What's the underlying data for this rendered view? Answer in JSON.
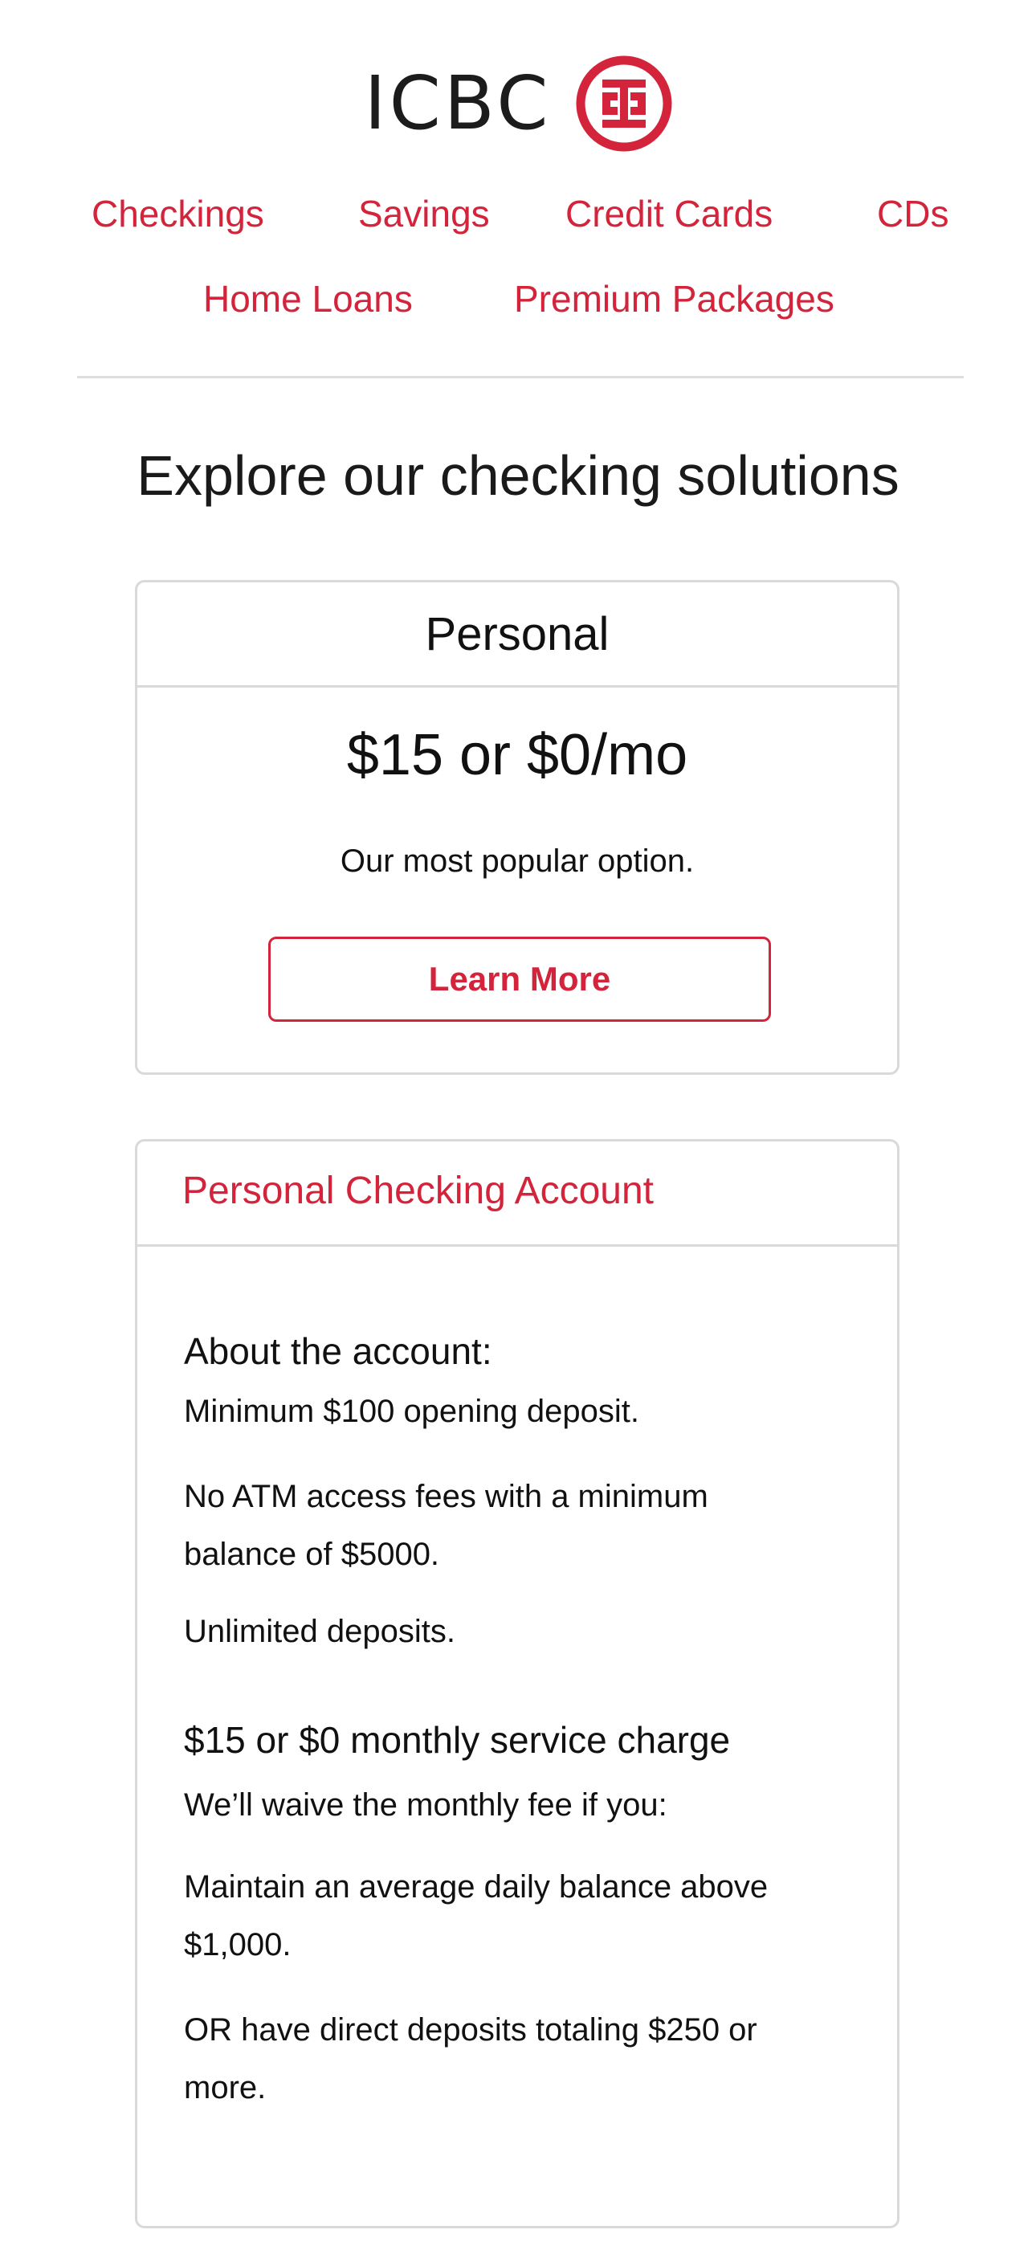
{
  "header": {
    "logo_text": "ICBC"
  },
  "nav": {
    "items": [
      "Checkings",
      "Savings",
      "Credit Cards",
      "CDs",
      "Home Loans",
      "Premium Packages"
    ]
  },
  "page": {
    "title": "Explore our checking solutions"
  },
  "plan_card": {
    "title": "Personal",
    "price": "$15 or $0/mo",
    "tagline": "Our most popular option.",
    "button_label": "Learn More"
  },
  "details_card": {
    "title": "Personal Checking Account",
    "about_heading": "About the account:",
    "about_items": [
      "Minimum $100 opening deposit.",
      "No ATM access fees with a minimum balance of $5000.",
      "Unlimited deposits."
    ],
    "fee_heading": "$15 or $0 monthly service charge",
    "fee_intro": "We’ll waive the monthly fee if you:",
    "fee_items": [
      "Maintain an average daily balance above $1,000.",
      "OR have direct deposits totaling $250 or more."
    ]
  },
  "colors": {
    "accent": "#d3243b",
    "text": "#111111",
    "border": "#d9d9d9"
  }
}
